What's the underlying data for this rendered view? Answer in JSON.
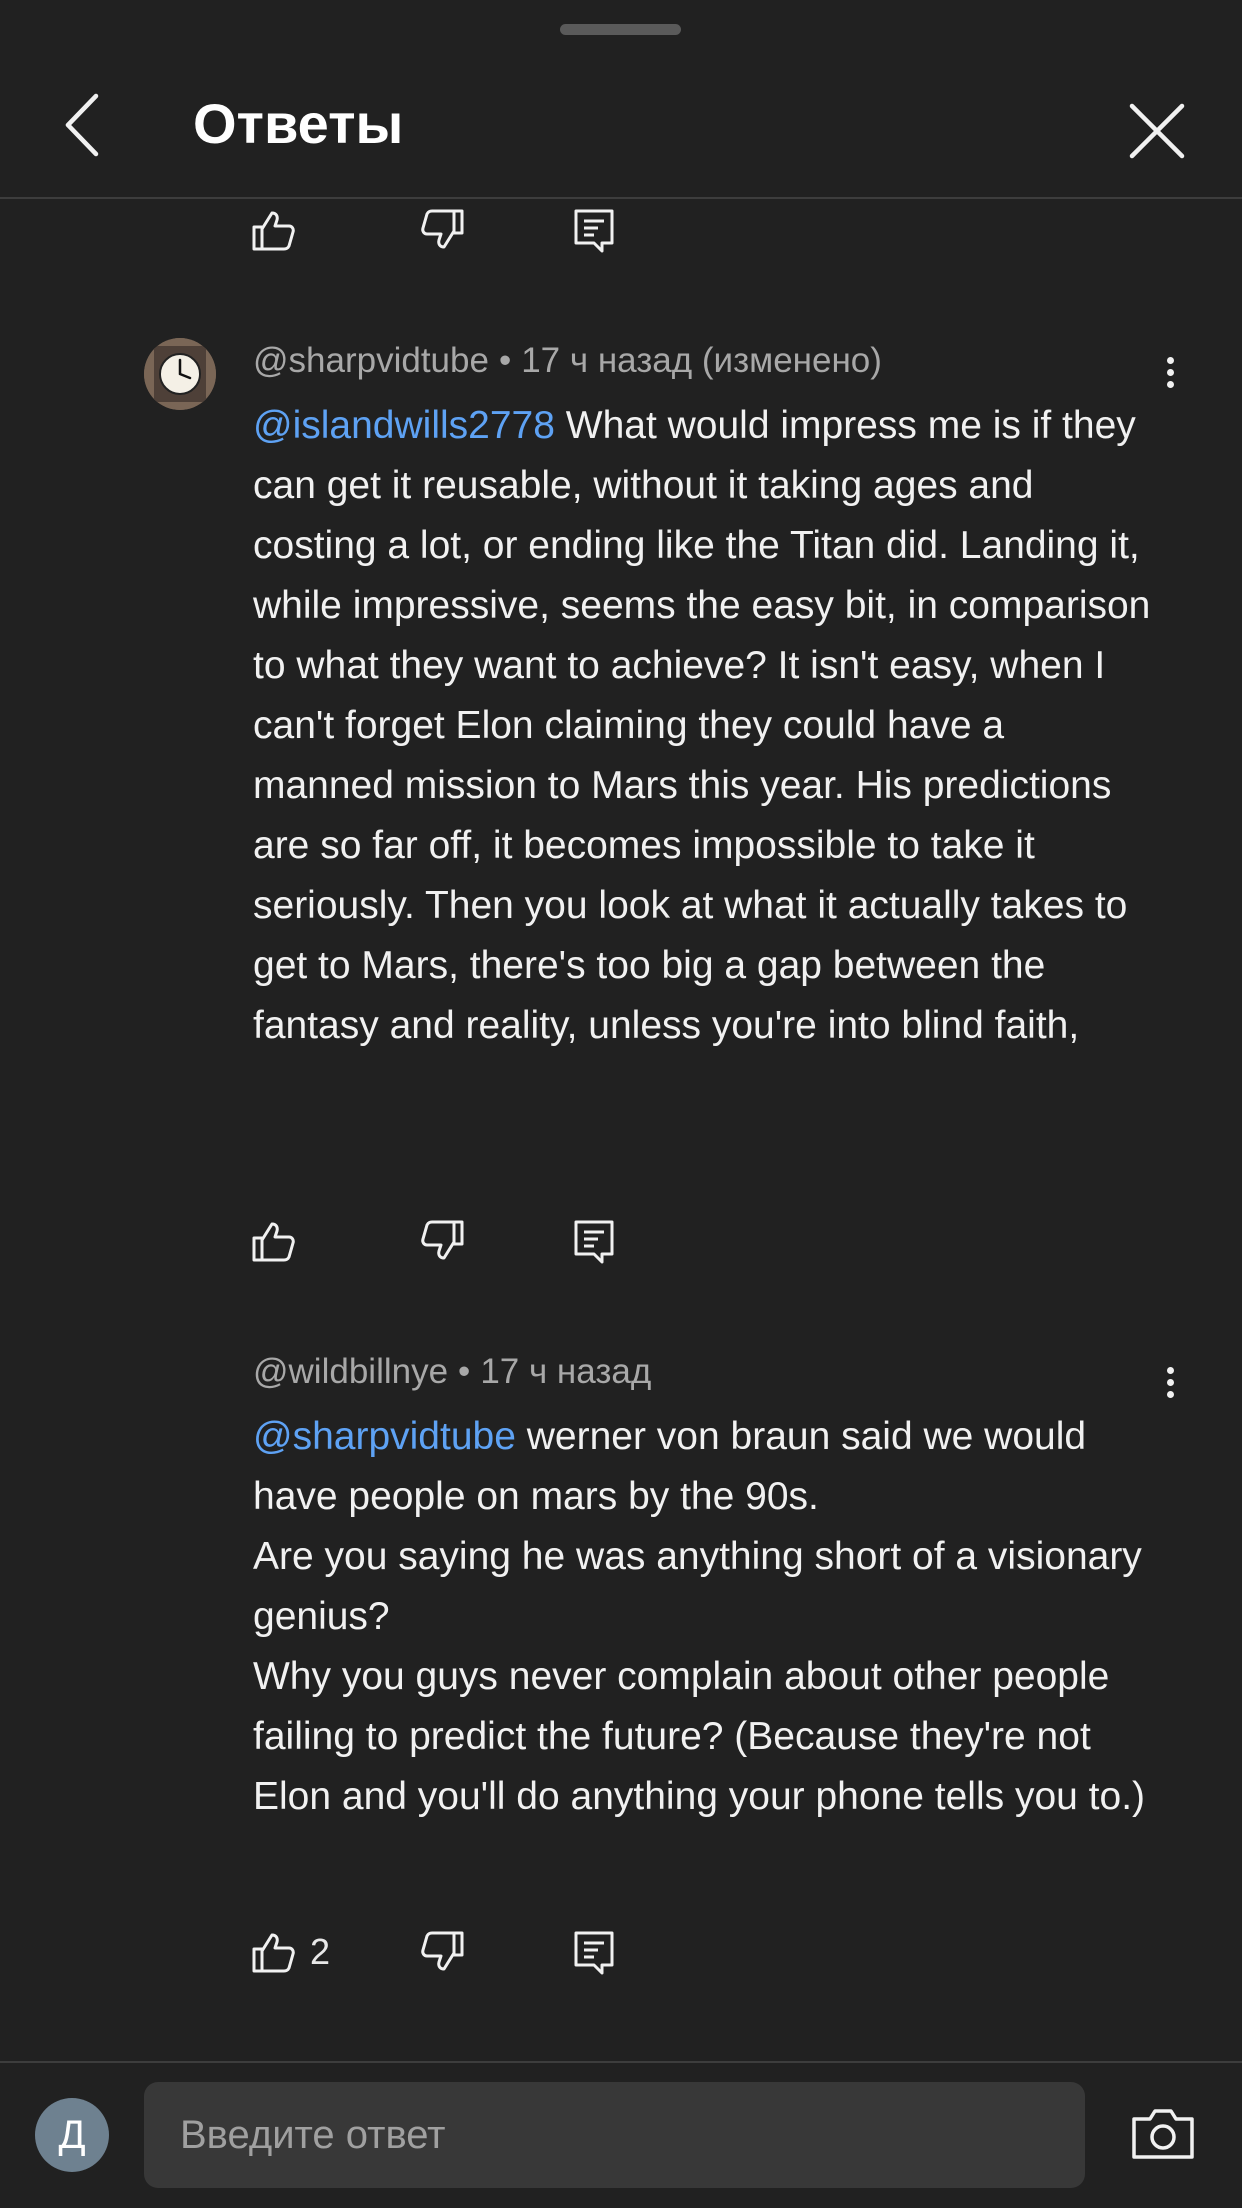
{
  "header": {
    "title": "Ответы"
  },
  "comments": [
    {
      "author": "@sharpvidtube",
      "time": "17 ч назад (изменено)",
      "mention": "@islandwills2778",
      "text": " What would impress me is if they can get it reusable, without it taking ages and costing a lot, or ending like the Titan did. Landing it, while impressive, seems the easy bit, in comparison to what they want to achieve? It isn't easy, when I can't forget Elon claiming they could have a manned mission to Mars this year. His predictions are so far off, it becomes impossible to take it seriously. Then you look at what it actually takes to get to Mars, there's too big a gap between the fantasy and reality, unless you're into blind faith,"
    },
    {
      "author": "@wildbillnye",
      "time": "17 ч назад",
      "mention": "@sharpvidtube",
      "text": " werner von braun said we would have people on mars by the 90s.\nAre you saying he was anything short of a visionary genius?\nWhy you guys never complain about other people failing to predict the future? (Because they're not Elon and you'll do anything your phone tells you to.)",
      "likes": "2"
    }
  ],
  "composer": {
    "avatar_letter": "Д",
    "placeholder": "Введите ответ"
  },
  "icons": [
    "back-icon",
    "close-icon",
    "like-icon",
    "dislike-icon",
    "reply-icon",
    "more-icon",
    "camera-icon"
  ],
  "colors": {
    "background": "#212121",
    "mention": "#5ea2f4",
    "input": "#383838"
  }
}
